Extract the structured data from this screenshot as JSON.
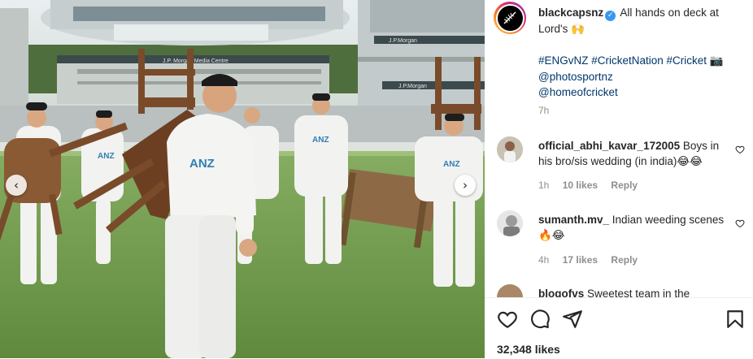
{
  "post": {
    "username": "blackcapsnz",
    "caption_text": "All hands on deck at Lord's",
    "caption_emoji": "🙌",
    "hashtags": "#ENGvNZ #CricketNation #Cricket",
    "hashtags_emoji": "📷",
    "mention_1": "@photosportnz",
    "mention_2": "@homeofcricket",
    "time": "7h",
    "likes": "32,348 likes"
  },
  "photo": {
    "signage_1": "J.P. Morgan Media Centre",
    "signage_2": "J.P.Morgan",
    "signage_3": "J.P.Morgan",
    "shirt_sponsor": "ANZ"
  },
  "comments": [
    {
      "username": "official_abhi_kavar_172005",
      "text": "Boys in his bro/sis wedding (in india)",
      "emoji": "😂😂",
      "time": "1h",
      "likes": "10 likes",
      "reply": "Reply"
    },
    {
      "username": "sumanth.mv_",
      "text": "Indian weeding scenes",
      "emoji": "🔥😂",
      "time": "4h",
      "likes": "17 likes",
      "reply": "Reply"
    },
    {
      "username": "blogofvs",
      "text": "Sweetest team in the"
    }
  ],
  "icons": {
    "carousel_prev": "chevron-left-icon",
    "carousel_next": "chevron-right-icon",
    "like": "heart-icon",
    "comment": "comment-icon",
    "share": "paper-plane-icon",
    "save": "bookmark-icon",
    "verified": "verified-badge-icon"
  },
  "colors": {
    "text": "#262626",
    "secondary": "#8e8e8e",
    "link": "#00376b",
    "verified": "#3897f0"
  }
}
